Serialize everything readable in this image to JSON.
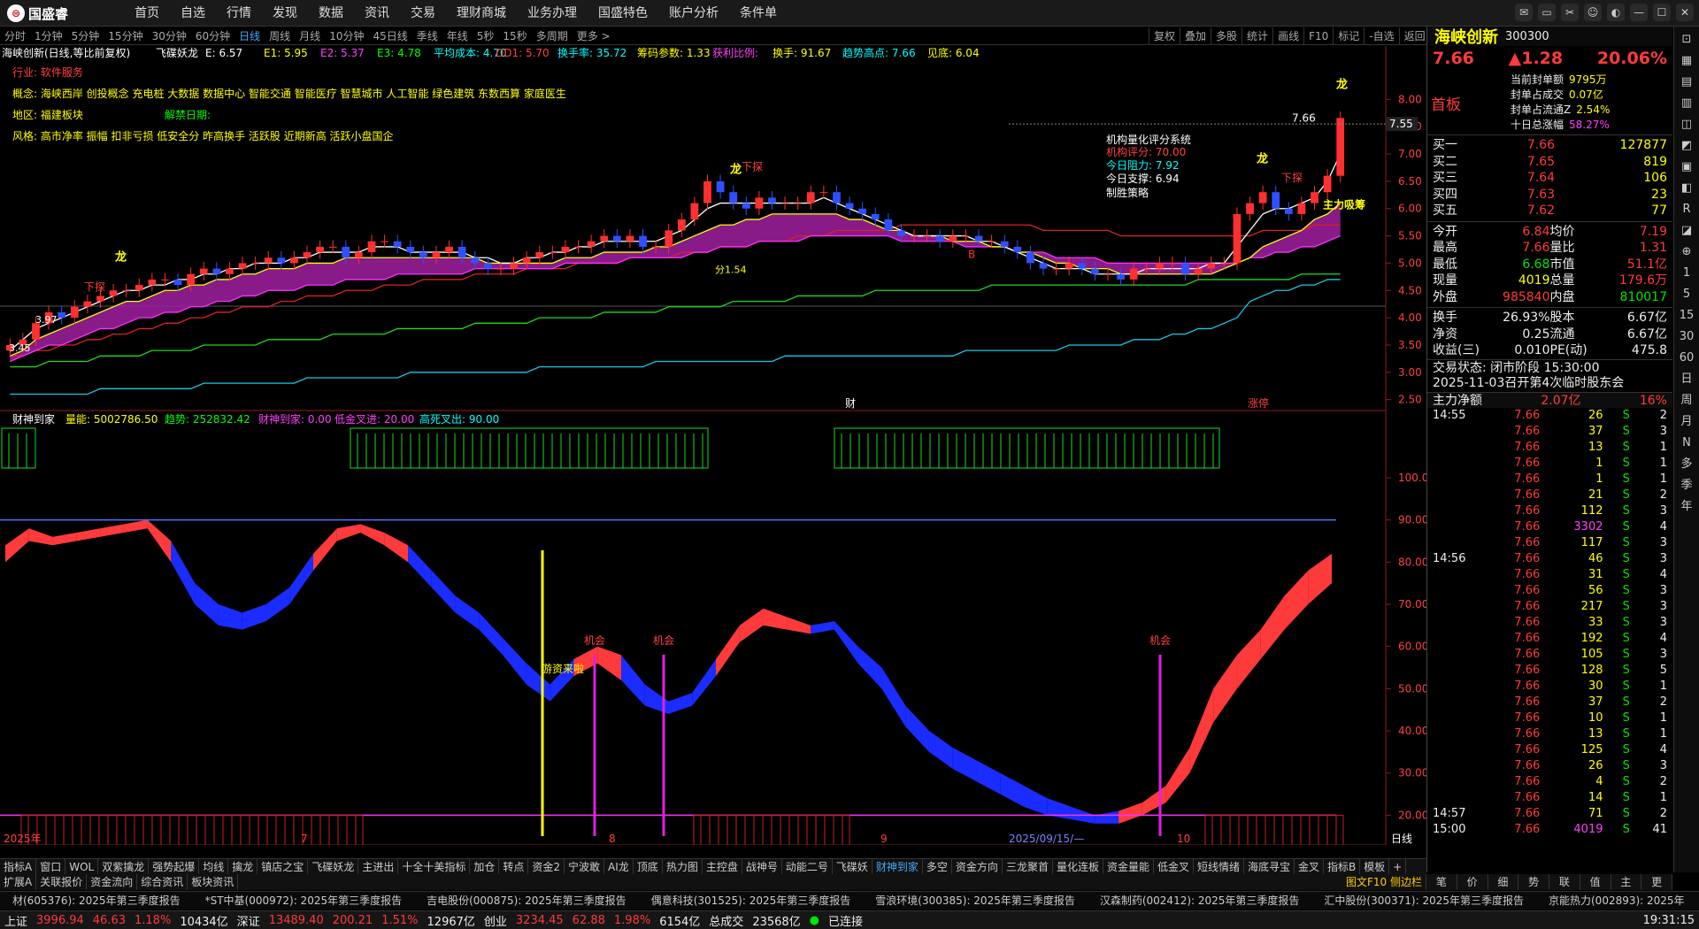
{
  "topbar": {
    "logo": "国盛睿",
    "menu": [
      "首页",
      "自选",
      "行情",
      "发现",
      "数据",
      "资讯",
      "交易",
      "理财商城",
      "业务办理",
      "国盛特色",
      "账户分析",
      "条件单"
    ]
  },
  "periods": [
    "分时",
    "1分钟",
    "5分钟",
    "15分钟",
    "30分钟",
    "60分钟",
    "日线",
    "周线",
    "月线",
    "10分钟",
    "45日线",
    "季线",
    "年线",
    "5秒",
    "15秒",
    "多周期",
    "更多 >"
  ],
  "active_period": "日线",
  "tools": [
    "复权",
    "叠加",
    "多股",
    "统计",
    "画线",
    "F10",
    "标记",
    "-自选",
    "返回"
  ],
  "chart_info": {
    "title": "海峡创新(日线,等比前复权)",
    "indicator": "飞碟妖龙",
    "e": "E: 6.57",
    "e1": "E1: 5.95",
    "e2": "E2: 5.37",
    "e3": "E3: 4.78",
    "avgcost": "平均成本: 4.70",
    "dd1": "DD1: 5.70",
    "turnover": "换手率: 35.72",
    "chip": "筹码参数: 1.33",
    "profit": "获利比例:",
    "hand": "换手: 91.67",
    "trendhigh": "趋势高点: 7.66",
    "bottom": "见底: 6.04",
    "industry": "行业: 软件服务",
    "concept": "概念: 海峡西岸 创投概念 充电桩 大数据 数据中心 智能交通 智能医疗 智慧城市 人工智能 绿色建筑 东数西算 家庭医生",
    "region": "地区: 福建板块",
    "unlock": "解禁日期:",
    "style": "风格: 高市净率 振幅 扣非亏损 低安全分 昨高换手 活跃股 近期新高 活跃小盘国企",
    "inst_title": "机构量化评分系统",
    "inst_score": "机构评分: 70.00",
    "inst_res": "今日阻力: 7.92",
    "inst_sup": "今日支撑: 6.94",
    "inst_win": "制胜策略",
    "price_tag": "7.66",
    "price_axis_tag": "7.55",
    "low_tag": "3.97",
    "low2_tag": "3.45",
    "mark_long": "龙",
    "mark_xiazhen": "下探",
    "mark_zhuli": "主力吸筹",
    "mark_cai": "财",
    "mark_zhangting": "涨停",
    "mark_fen": "分1.54",
    "mark_b": "B"
  },
  "price_axis": [
    "8.00",
    "7.50",
    "7.00",
    "6.50",
    "6.00",
    "5.50",
    "5.00",
    "4.50",
    "4.00",
    "3.50",
    "3.00",
    "2.50"
  ],
  "osc_axis": [
    "100.0",
    "90.00",
    "80.00",
    "70.00",
    "60.00",
    "50.00",
    "40.00",
    "30.00",
    "20.00"
  ],
  "osc_info": {
    "name": "财神到家",
    "energy": "量能: 5002786.50",
    "trend": "趋势: 252832.42",
    "caishen": "财神到家: 0.00",
    "low": "低金叉进: 20.00",
    "high": "高死叉出: 90.00",
    "jihui": "机会",
    "youzi": "游资来啦"
  },
  "xaxis": {
    "labels": [
      "2025年",
      "7",
      "8",
      "9",
      "2025/09/15/—",
      "10"
    ],
    "period_label": "日线"
  },
  "chart_data": {
    "type": "line",
    "title": "海峡创新(日线,等比前复权)",
    "ylim": [
      2.3,
      8.2
    ],
    "osc_ylim": [
      14,
      100
    ],
    "close": [
      3.5,
      3.6,
      3.9,
      4.1,
      4.0,
      4.2,
      4.3,
      4.4,
      4.5,
      4.5,
      4.6,
      4.7,
      4.7,
      4.6,
      4.8,
      4.9,
      4.8,
      4.9,
      5.0,
      5.0,
      5.1,
      5.0,
      5.1,
      5.2,
      5.3,
      5.3,
      5.1,
      5.2,
      5.4,
      5.4,
      5.3,
      5.2,
      5.1,
      5.2,
      5.3,
      5.1,
      5.0,
      4.9,
      4.9,
      5.0,
      5.1,
      5.2,
      5.2,
      5.3,
      5.3,
      5.4,
      5.5,
      5.4,
      5.5,
      5.3,
      5.3,
      5.6,
      5.8,
      6.1,
      6.5,
      6.3,
      6.1,
      6.0,
      6.2,
      6.1,
      6.1,
      6.1,
      6.3,
      6.3,
      6.1,
      6.0,
      5.9,
      5.8,
      5.6,
      5.5,
      5.5,
      5.5,
      5.4,
      5.5,
      5.5,
      5.4,
      5.4,
      5.3,
      5.2,
      5.0,
      4.9,
      4.9,
      5.0,
      4.9,
      4.8,
      4.8,
      4.7,
      4.9,
      4.9,
      5.0,
      5.0,
      4.8,
      4.9,
      5.0,
      5.0,
      5.9,
      6.1,
      6.3,
      6.0,
      5.9,
      6.1,
      6.3,
      6.6,
      7.66
    ],
    "ma_white": [
      3.4,
      3.6,
      3.8,
      3.9,
      4.0,
      4.1,
      4.2,
      4.3,
      4.4,
      4.5,
      4.5,
      4.6,
      4.6,
      4.7,
      4.7,
      4.8,
      4.8,
      4.9,
      4.9,
      5.0,
      5.0,
      5.0,
      5.1,
      5.1,
      5.2,
      5.2,
      5.2,
      5.2,
      5.3,
      5.3,
      5.3,
      5.2,
      5.2,
      5.2,
      5.2,
      5.2,
      5.1,
      5.1,
      5.0,
      5.0,
      5.1,
      5.1,
      5.2,
      5.2,
      5.3,
      5.3,
      5.4,
      5.4,
      5.4,
      5.4,
      5.4,
      5.5,
      5.6,
      5.8,
      6.0,
      6.1,
      6.1,
      6.1,
      6.1,
      6.1,
      6.1,
      6.1,
      6.1,
      6.2,
      6.1,
      6.0,
      5.9,
      5.8,
      5.7,
      5.6,
      5.5,
      5.5,
      5.5,
      5.5,
      5.5,
      5.4,
      5.4,
      5.3,
      5.2,
      5.1,
      5.0,
      4.9,
      4.9,
      4.9,
      4.8,
      4.8,
      4.8,
      4.8,
      4.9,
      4.9,
      4.9,
      4.9,
      4.9,
      5.0,
      5.0,
      5.3,
      5.6,
      5.9,
      6.0,
      6.0,
      6.1,
      6.2,
      6.5,
      7.0
    ],
    "ma_yellow": [
      3.3,
      3.4,
      3.6,
      3.7,
      3.8,
      3.9,
      4.0,
      4.1,
      4.2,
      4.3,
      4.3,
      4.4,
      4.5,
      4.5,
      4.6,
      4.6,
      4.7,
      4.7,
      4.8,
      4.8,
      4.9,
      4.9,
      4.9,
      5.0,
      5.0,
      5.0,
      5.1,
      5.1,
      5.1,
      5.1,
      5.1,
      5.1,
      5.1,
      5.1,
      5.1,
      5.1,
      5.1,
      5.0,
      5.0,
      5.0,
      5.0,
      5.0,
      5.0,
      5.1,
      5.1,
      5.1,
      5.2,
      5.2,
      5.2,
      5.2,
      5.3,
      5.3,
      5.4,
      5.5,
      5.6,
      5.7,
      5.7,
      5.8,
      5.8,
      5.9,
      5.9,
      5.9,
      5.9,
      5.9,
      5.9,
      5.8,
      5.8,
      5.7,
      5.6,
      5.6,
      5.5,
      5.5,
      5.5,
      5.4,
      5.4,
      5.4,
      5.3,
      5.3,
      5.2,
      5.2,
      5.1,
      5.0,
      5.0,
      4.9,
      4.9,
      4.9,
      4.8,
      4.8,
      4.8,
      4.8,
      4.8,
      4.8,
      4.8,
      4.8,
      4.9,
      5.0,
      5.1,
      5.3,
      5.4,
      5.5,
      5.6,
      5.8,
      5.9,
      6.1
    ],
    "ma_magenta": [
      3.2,
      3.3,
      3.4,
      3.5,
      3.5,
      3.6,
      3.7,
      3.8,
      3.8,
      3.9,
      4.0,
      4.0,
      4.1,
      4.1,
      4.2,
      4.2,
      4.3,
      4.3,
      4.4,
      4.4,
      4.5,
      4.5,
      4.5,
      4.6,
      4.6,
      4.6,
      4.7,
      4.7,
      4.7,
      4.7,
      4.8,
      4.8,
      4.8,
      4.8,
      4.8,
      4.8,
      4.9,
      4.9,
      4.9,
      4.9,
      4.9,
      4.9,
      4.9,
      5.0,
      5.0,
      5.0,
      5.0,
      5.0,
      5.1,
      5.1,
      5.1,
      5.1,
      5.1,
      5.2,
      5.2,
      5.3,
      5.3,
      5.3,
      5.4,
      5.4,
      5.4,
      5.4,
      5.5,
      5.5,
      5.5,
      5.5,
      5.5,
      5.5,
      5.5,
      5.4,
      5.4,
      5.4,
      5.4,
      5.4,
      5.3,
      5.3,
      5.3,
      5.3,
      5.2,
      5.2,
      5.2,
      5.1,
      5.1,
      5.1,
      5.1,
      5.0,
      5.0,
      5.0,
      5.0,
      5.0,
      5.0,
      5.0,
      5.0,
      5.0,
      5.0,
      5.0,
      5.1,
      5.1,
      5.2,
      5.2,
      5.3,
      5.3,
      5.4,
      5.5
    ],
    "ma_red": [
      3.3,
      3.3,
      3.4,
      3.4,
      3.5,
      3.5,
      3.6,
      3.6,
      3.7,
      3.7,
      3.8,
      3.8,
      3.9,
      3.9,
      4.0,
      4.0,
      4.1,
      4.1,
      4.2,
      4.2,
      4.2,
      4.3,
      4.3,
      4.4,
      4.4,
      4.4,
      4.5,
      4.5,
      4.5,
      4.6,
      4.6,
      4.6,
      4.7,
      4.7,
      4.7,
      4.7,
      4.8,
      4.8,
      4.8,
      4.8,
      4.9,
      4.9,
      4.9,
      4.9,
      5.0,
      5.0,
      5.0,
      5.0,
      5.1,
      5.1,
      5.1,
      5.1,
      5.2,
      5.2,
      5.2,
      5.3,
      5.3,
      5.3,
      5.4,
      5.4,
      5.4,
      5.5,
      5.5,
      5.5,
      5.6,
      5.6,
      5.6,
      5.6,
      5.6,
      5.7,
      5.7,
      5.7,
      5.7,
      5.7,
      5.7,
      5.7,
      5.7,
      5.7,
      5.7,
      5.7,
      5.6,
      5.6,
      5.6,
      5.6,
      5.6,
      5.6,
      5.5,
      5.5,
      5.5,
      5.5,
      5.5,
      5.5,
      5.5,
      5.5,
      5.5,
      5.5,
      5.5,
      5.6,
      5.6,
      5.6,
      5.6,
      5.7,
      5.7,
      5.7
    ],
    "ma_green": [
      3.1,
      3.1,
      3.1,
      3.2,
      3.2,
      3.2,
      3.2,
      3.3,
      3.3,
      3.3,
      3.3,
      3.4,
      3.4,
      3.4,
      3.4,
      3.5,
      3.5,
      3.5,
      3.5,
      3.5,
      3.6,
      3.6,
      3.6,
      3.6,
      3.6,
      3.7,
      3.7,
      3.7,
      3.7,
      3.7,
      3.8,
      3.8,
      3.8,
      3.8,
      3.8,
      3.8,
      3.9,
      3.9,
      3.9,
      3.9,
      3.9,
      4.0,
      4.0,
      4.0,
      4.0,
      4.0,
      4.1,
      4.1,
      4.1,
      4.1,
      4.1,
      4.2,
      4.2,
      4.2,
      4.2,
      4.2,
      4.3,
      4.3,
      4.3,
      4.3,
      4.3,
      4.4,
      4.4,
      4.4,
      4.4,
      4.4,
      4.4,
      4.5,
      4.5,
      4.5,
      4.5,
      4.5,
      4.5,
      4.5,
      4.5,
      4.5,
      4.6,
      4.6,
      4.6,
      4.6,
      4.6,
      4.6,
      4.6,
      4.6,
      4.6,
      4.6,
      4.6,
      4.6,
      4.6,
      4.6,
      4.6,
      4.6,
      4.7,
      4.7,
      4.7,
      4.7,
      4.7,
      4.7,
      4.7,
      4.7,
      4.8,
      4.8,
      4.8,
      4.8
    ],
    "ma_cyan": [
      2.6,
      2.6,
      2.6,
      2.6,
      2.6,
      2.6,
      2.6,
      2.7,
      2.7,
      2.7,
      2.7,
      2.7,
      2.7,
      2.7,
      2.7,
      2.8,
      2.8,
      2.8,
      2.8,
      2.8,
      2.8,
      2.8,
      2.8,
      2.9,
      2.9,
      2.9,
      2.9,
      2.9,
      2.9,
      2.9,
      2.9,
      3.0,
      3.0,
      3.0,
      3.0,
      3.0,
      3.0,
      3.0,
      3.0,
      3.0,
      3.0,
      3.1,
      3.1,
      3.1,
      3.1,
      3.1,
      3.1,
      3.1,
      3.1,
      3.1,
      3.2,
      3.2,
      3.2,
      3.2,
      3.2,
      3.2,
      3.2,
      3.2,
      3.2,
      3.2,
      3.3,
      3.3,
      3.3,
      3.3,
      3.3,
      3.3,
      3.3,
      3.3,
      3.3,
      3.3,
      3.3,
      3.3,
      3.3,
      3.3,
      3.4,
      3.4,
      3.4,
      3.4,
      3.4,
      3.4,
      3.4,
      3.4,
      3.5,
      3.5,
      3.5,
      3.5,
      3.5,
      3.6,
      3.6,
      3.6,
      3.7,
      3.7,
      3.8,
      3.8,
      3.9,
      4.0,
      4.3,
      4.4,
      4.5,
      4.5,
      4.6,
      4.6,
      4.7,
      4.7
    ],
    "osc_upper": [
      84,
      88,
      86,
      87,
      88,
      89,
      90,
      85,
      75,
      70,
      68,
      70,
      74,
      82,
      88,
      89,
      87,
      84,
      78,
      72,
      68,
      62,
      56,
      51,
      57,
      60,
      58,
      51,
      47,
      49,
      57,
      65,
      69,
      67,
      65,
      66,
      60,
      55,
      46,
      40,
      36,
      33,
      30,
      27,
      24,
      22,
      20,
      21,
      23,
      27,
      36,
      50,
      58,
      64,
      72,
      78,
      82
    ],
    "osc_lower": [
      80,
      85,
      84,
      85,
      86,
      87,
      88,
      80,
      70,
      65,
      64,
      66,
      70,
      78,
      85,
      87,
      84,
      80,
      74,
      68,
      64,
      58,
      51,
      47,
      53,
      56,
      52,
      46,
      44,
      46,
      53,
      61,
      65,
      64,
      63,
      64,
      56,
      50,
      41,
      35,
      31,
      28,
      25,
      22,
      20,
      19,
      18,
      18,
      20,
      23,
      30,
      42,
      50,
      57,
      64,
      70,
      75
    ],
    "osc_color": [
      "r",
      "r",
      "r",
      "r",
      "r",
      "r",
      "r",
      "b",
      "b",
      "b",
      "b",
      "b",
      "b",
      "r",
      "r",
      "r",
      "r",
      "b",
      "b",
      "b",
      "b",
      "b",
      "b",
      "b",
      "r",
      "r",
      "b",
      "b",
      "b",
      "b",
      "r",
      "r",
      "r",
      "r",
      "b",
      "b",
      "b",
      "b",
      "b",
      "b",
      "b",
      "b",
      "b",
      "b",
      "b",
      "b",
      "b",
      "r",
      "r",
      "r",
      "r",
      "r",
      "r",
      "r",
      "r",
      "r",
      "r"
    ]
  },
  "side": {
    "name": "海峡创新",
    "code": "300300",
    "price": "7.66",
    "change": "▲1.28",
    "pct": "20.06%",
    "limitup_label": "首板",
    "seal": [
      [
        "当前封单额",
        "9795万"
      ],
      [
        "封单占成交",
        "0.07亿"
      ],
      [
        "封单占流通Z",
        "2.54%"
      ],
      [
        "十日总涨幅",
        "58.27%"
      ]
    ],
    "bids": [
      [
        "买一",
        "7.66",
        "127877"
      ],
      [
        "买二",
        "7.65",
        "819"
      ],
      [
        "买三",
        "7.64",
        "106"
      ],
      [
        "买四",
        "7.63",
        "23"
      ],
      [
        "买五",
        "7.62",
        "77"
      ]
    ],
    "stats": [
      [
        "今开",
        "6.84",
        "均价",
        "7.19"
      ],
      [
        "最高",
        "7.66",
        "量比",
        "1.31"
      ],
      [
        "最低",
        "6.68",
        "市值",
        "51.1亿"
      ],
      [
        "现量",
        "4019",
        "总量",
        "179.6万"
      ],
      [
        "外盘",
        "985840",
        "内盘",
        "810017"
      ]
    ],
    "stats2": [
      [
        "换手",
        "26.93%",
        "股本",
        "6.67亿"
      ],
      [
        "净资",
        "0.25",
        "流通",
        "6.67亿"
      ],
      [
        "收益(三)",
        "0.010",
        "PE(动)",
        "475.8"
      ]
    ],
    "trade_state": "交易状态: 闭市阶段 15:30:00",
    "notice": "2025-11-03召开第4次临时股东会",
    "net_label": "主力净额",
    "net_val": "2.07亿",
    "net_pct": "16%",
    "ticks": [
      [
        "14:55",
        "7.66",
        "26",
        "S",
        "2"
      ],
      [
        "",
        "7.66",
        "37",
        "S",
        "3"
      ],
      [
        "",
        "7.66",
        "13",
        "S",
        "1"
      ],
      [
        "",
        "7.66",
        "1",
        "S",
        "1"
      ],
      [
        "",
        "7.66",
        "1",
        "S",
        "1"
      ],
      [
        "",
        "7.66",
        "21",
        "S",
        "2"
      ],
      [
        "",
        "7.66",
        "112",
        "S",
        "3"
      ],
      [
        "",
        "7.66",
        "3302",
        "S",
        "4"
      ],
      [
        "",
        "7.66",
        "117",
        "S",
        "3"
      ],
      [
        "14:56",
        "7.66",
        "46",
        "S",
        "3"
      ],
      [
        "",
        "7.66",
        "31",
        "S",
        "4"
      ],
      [
        "",
        "7.66",
        "56",
        "S",
        "3"
      ],
      [
        "",
        "7.66",
        "217",
        "S",
        "3"
      ],
      [
        "",
        "7.66",
        "33",
        "S",
        "3"
      ],
      [
        "",
        "7.66",
        "192",
        "S",
        "4"
      ],
      [
        "",
        "7.66",
        "105",
        "S",
        "3"
      ],
      [
        "",
        "7.66",
        "128",
        "S",
        "5"
      ],
      [
        "",
        "7.66",
        "30",
        "S",
        "1"
      ],
      [
        "",
        "7.66",
        "37",
        "S",
        "2"
      ],
      [
        "",
        "7.66",
        "10",
        "S",
        "1"
      ],
      [
        "",
        "7.66",
        "13",
        "S",
        "1"
      ],
      [
        "",
        "7.66",
        "125",
        "S",
        "4"
      ],
      [
        "",
        "7.66",
        "26",
        "S",
        "3"
      ],
      [
        "",
        "7.66",
        "4",
        "S",
        "2"
      ],
      [
        "",
        "7.66",
        "14",
        "S",
        "1"
      ],
      [
        "14:57",
        "7.66",
        "71",
        "S",
        "2"
      ],
      [
        "15:00",
        "7.66",
        "4019",
        "S",
        "41"
      ]
    ],
    "sidetabs": [
      "笔",
      "价",
      "细",
      "势",
      "联",
      "值",
      "主",
      "更"
    ]
  },
  "farright": [
    "⊡",
    "▦",
    "▤",
    "▥",
    "◫",
    "◩",
    "▣",
    "◧",
    "R",
    "◪",
    "⊕",
    "1",
    "5",
    "15",
    "30",
    "60",
    "日",
    "周",
    "月",
    "N",
    "多",
    "季",
    "年"
  ],
  "bottomtabs1": [
    "指标A",
    "窗口",
    "WOL",
    "双紫擒龙",
    "强势起爆",
    "均线",
    "擒龙",
    "镇店之宝",
    "飞碟妖龙",
    "主进出",
    "十全十美指标",
    "加仓",
    "转点",
    "资金2",
    "宁波敢",
    "AI龙",
    "顶底",
    "热力图",
    "主控盘",
    "战神号",
    "动能二号",
    "飞碟妖",
    "财神到家",
    "多空",
    "资金方向",
    "三龙聚首",
    "量化连板",
    "资金量能",
    "低金叉",
    "短线情绪",
    "海底寻宝",
    "金叉",
    "指标B",
    "模板",
    "+"
  ],
  "bottomtabs2": [
    "扩展A",
    "关联报价",
    "资金流向",
    "综合资讯",
    "板块资讯"
  ],
  "bottomtabs2_right": "图文F10 侧边栏",
  "news": [
    "材(605376): 2025年第三季度报告",
    "*ST中基(000972): 2025年第三季度报告",
    "吉电股份(000875): 2025年第三季度报告",
    "偶意科技(301525): 2025年第三季度报告",
    "雪浪环境(300385): 2025年第三季度报告",
    "汉森制药(002412): 2025年第三季度报告",
    "汇中股份(300371): 2025年第三季度报告",
    "京能热力(002893): 2025年"
  ],
  "status": {
    "sh": "上证",
    "sh_v": "3996.94",
    "sh_c": "46.63",
    "sh_p": "1.18%",
    "sh_a": "10434亿",
    "sz": "深证",
    "sz_v": "13489.40",
    "sz_c": "200.21",
    "sz_p": "1.51%",
    "sz_a": "12967亿",
    "cy": "创业",
    "cy_v": "3234.45",
    "cy_c": "62.88",
    "cy_p": "1.98%",
    "cy_a": "6154亿",
    "total": "总成交",
    "total_v": "23568亿",
    "conn": "已连接",
    "time": "19:31:15"
  }
}
